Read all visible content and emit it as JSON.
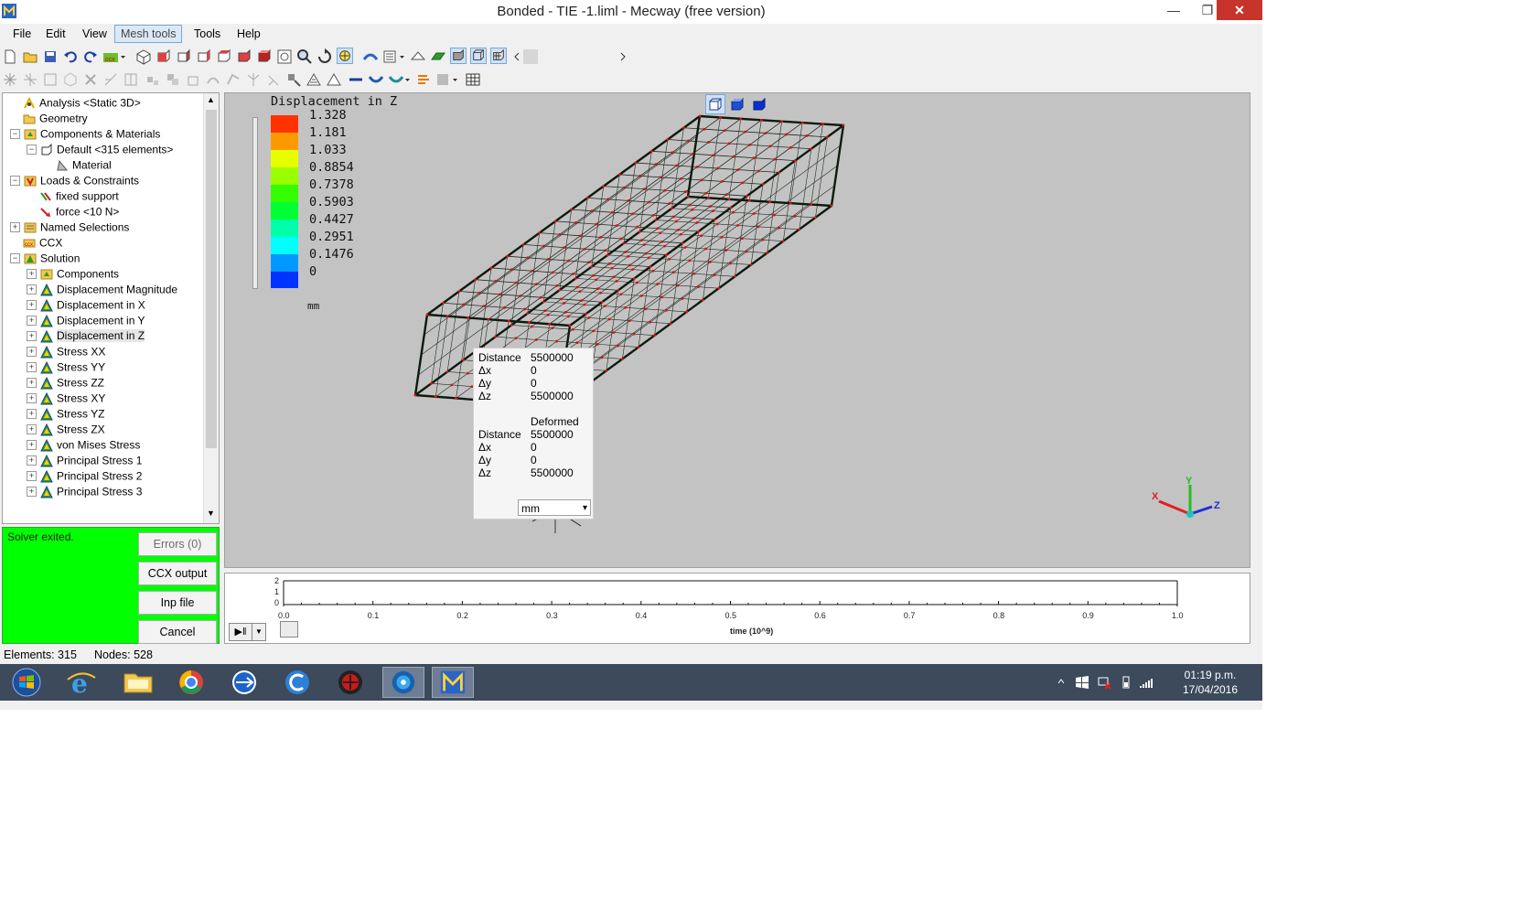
{
  "window": {
    "title": "Bonded - TIE -1.liml - Mecway (free version)",
    "min_glyph": "—",
    "max_glyph": "❐",
    "close_glyph": "✕"
  },
  "menu": [
    "File",
    "Edit",
    "View",
    "Mesh tools",
    "Tools",
    "Help"
  ],
  "menu_active": "Mesh tools",
  "tree": {
    "items": [
      {
        "label": "Analysis <Static 3D>",
        "icon": "analysis-icon"
      },
      {
        "label": "Geometry",
        "icon": "folder-icon"
      },
      {
        "label": "Components & Materials",
        "icon": "components-icon"
      },
      {
        "label": "Default <315 elements>",
        "icon": "component-icon"
      },
      {
        "label": "Material",
        "icon": "material-icon"
      },
      {
        "label": "Loads & Constraints",
        "icon": "loads-icon"
      },
      {
        "label": "fixed support",
        "icon": "constraint-icon"
      },
      {
        "label": "force <10 N>",
        "icon": "force-icon"
      },
      {
        "label": "Named Selections",
        "icon": "named-selections-icon"
      },
      {
        "label": "CCX",
        "icon": "ccx-icon"
      },
      {
        "label": "Solution",
        "icon": "solution-icon"
      },
      {
        "label": "Components",
        "icon": "components-icon"
      },
      {
        "label": "Displacement Magnitude",
        "icon": "result-icon"
      },
      {
        "label": "Displacement in X",
        "icon": "result-icon"
      },
      {
        "label": "Displacement in Y",
        "icon": "result-icon"
      },
      {
        "label": "Displacement in Z",
        "icon": "result-icon"
      },
      {
        "label": "Stress XX",
        "icon": "result-icon"
      },
      {
        "label": "Stress YY",
        "icon": "result-icon"
      },
      {
        "label": "Stress ZZ",
        "icon": "result-icon"
      },
      {
        "label": "Stress XY",
        "icon": "result-icon"
      },
      {
        "label": "Stress YZ",
        "icon": "result-icon"
      },
      {
        "label": "Stress ZX",
        "icon": "result-icon"
      },
      {
        "label": "von Mises Stress",
        "icon": "result-icon"
      },
      {
        "label": "Principal Stress 1",
        "icon": "result-icon"
      },
      {
        "label": "Principal Stress 2",
        "icon": "result-icon"
      },
      {
        "label": "Principal Stress 3",
        "icon": "result-icon"
      }
    ],
    "selected": "Displacement in Z"
  },
  "solver": {
    "status": "Solver exited.",
    "errors_label": "Errors (0)",
    "ccx_output_label": "CCX output",
    "inp_file_label": "Inp file",
    "cancel_label": "Cancel"
  },
  "legend": {
    "title": "Displacement in Z",
    "values": [
      "1.328",
      "1.181",
      "1.033",
      "0.8854",
      "0.7378",
      "0.5903",
      "0.4427",
      "0.2951",
      "0.1476",
      "0"
    ],
    "colors": [
      "#ff3300",
      "#ff9900",
      "#e6ff00",
      "#99ff00",
      "#33ff00",
      "#00ff33",
      "#00ffaa",
      "#00ffff",
      "#0099ff",
      "#0033ff"
    ],
    "unit": "mm"
  },
  "measure": {
    "distance_label": "Distance",
    "dx_label": "Δx",
    "dy_label": "Δy",
    "dz_label": "Δz",
    "distance": "5500000",
    "dx": "0",
    "dy": "0",
    "dz": "5500000",
    "deformed_label": "Deformed",
    "def_distance": "5500000",
    "def_dx": "0",
    "def_dy": "0",
    "def_dz": "5500000",
    "unit": "mm",
    "dropdown_glyph": "▾"
  },
  "axes": {
    "x": "X",
    "y": "Y",
    "z": "Z"
  },
  "timeline": {
    "ticks": [
      "0.0",
      "0.1",
      "0.2",
      "0.3",
      "0.4",
      "0.5",
      "0.6",
      "0.7",
      "0.8",
      "0.9",
      "1.0"
    ],
    "y_ticks": [
      "2",
      "1",
      "0"
    ],
    "xlabel": "time (10^9)",
    "play_glyph": "▶‖",
    "dropdown_glyph": "▼"
  },
  "status": {
    "elements": "Elements:  315",
    "nodes": "Nodes: 528"
  },
  "taskbar": {
    "time": "01:19 p.m.",
    "date": "17/04/2016"
  }
}
